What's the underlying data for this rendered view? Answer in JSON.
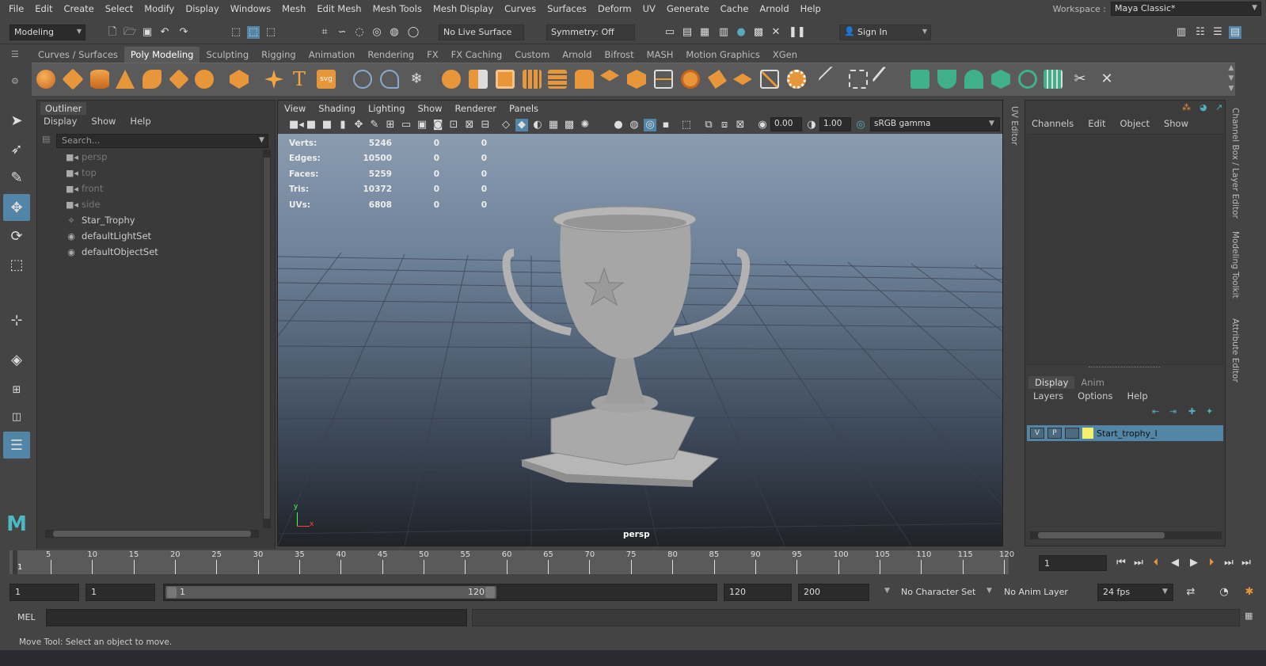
{
  "menubar": {
    "items": [
      "File",
      "Edit",
      "Create",
      "Select",
      "Modify",
      "Display",
      "Windows",
      "Mesh",
      "Edit Mesh",
      "Mesh Tools",
      "Mesh Display",
      "Curves",
      "Surfaces",
      "Deform",
      "UV",
      "Generate",
      "Cache",
      "Arnold",
      "Help"
    ],
    "workspace_label": "Workspace :",
    "workspace_value": "Maya Classic*"
  },
  "statusline": {
    "menuset": "Modeling",
    "live_surface": "No Live Surface",
    "symmetry": "Symmetry: Off",
    "sign_in": "Sign In"
  },
  "shelf": {
    "tabs": [
      "Curves / Surfaces",
      "Poly Modeling",
      "Sculpting",
      "Rigging",
      "Animation",
      "Rendering",
      "FX",
      "FX Caching",
      "Custom",
      "Arnold",
      "Bifrost",
      "MASH",
      "Motion Graphics",
      "XGen"
    ],
    "active_tab": "Poly Modeling",
    "text_icon": "T",
    "svg_icon": "svg"
  },
  "outliner": {
    "title": "Outliner",
    "menus": [
      "Display",
      "Show",
      "Help"
    ],
    "search_placeholder": "Search...",
    "items": [
      {
        "label": "persp",
        "icon": "camera-icon",
        "dim": true
      },
      {
        "label": "top",
        "icon": "camera-icon",
        "dim": true
      },
      {
        "label": "front",
        "icon": "camera-icon",
        "dim": true
      },
      {
        "label": "side",
        "icon": "camera-icon",
        "dim": true
      },
      {
        "label": "Star_Trophy",
        "icon": "transform-icon",
        "dim": false
      },
      {
        "label": "defaultLightSet",
        "icon": "set-icon",
        "dim": false
      },
      {
        "label": "defaultObjectSet",
        "icon": "set-icon",
        "dim": false
      }
    ]
  },
  "viewport": {
    "menus": [
      "View",
      "Shading",
      "Lighting",
      "Show",
      "Renderer",
      "Panels"
    ],
    "exposure": "0.00",
    "gamma": "1.00",
    "colorspace": "sRGB gamma",
    "camera_label": "persp",
    "hud": [
      {
        "key": "Verts:",
        "v1": "5246",
        "v2": "0",
        "v3": "0"
      },
      {
        "key": "Edges:",
        "v1": "10500",
        "v2": "0",
        "v3": "0"
      },
      {
        "key": "Faces:",
        "v1": "5259",
        "v2": "0",
        "v3": "0"
      },
      {
        "key": "Tris:",
        "v1": "10372",
        "v2": "0",
        "v3": "0"
      },
      {
        "key": "UVs:",
        "v1": "6808",
        "v2": "0",
        "v3": "0"
      }
    ],
    "axis_y": "y",
    "axis_x": "x"
  },
  "uv_editor_tab": "UV Editor",
  "channelbox": {
    "menus": [
      "Channels",
      "Edit",
      "Object",
      "Show"
    ],
    "layer_tabs": [
      "Display",
      "Anim"
    ],
    "layer_menus": [
      "Layers",
      "Options",
      "Help"
    ],
    "layer": {
      "v": "V",
      "p": "P",
      "name": "Start_trophy_l",
      "color": "#f5f06a"
    }
  },
  "side_tabs": [
    "Channel Box / Layer Editor",
    "Modeling Toolkit",
    "Attribute Editor"
  ],
  "timeline": {
    "ticks": [
      "5",
      "10",
      "15",
      "20",
      "25",
      "30",
      "35",
      "40",
      "45",
      "50",
      "55",
      "60",
      "65",
      "70",
      "75",
      "80",
      "85",
      "90",
      "95",
      "100",
      "105",
      "110",
      "115",
      "120"
    ],
    "first_tick": "1",
    "current_frame": "1"
  },
  "range": {
    "start": "1",
    "playback_start": "1",
    "slider_start": "1",
    "slider_end": "120",
    "playback_end": "120",
    "end": "200",
    "character_set": "No Character Set",
    "anim_layer": "No Anim Layer",
    "fps": "24 fps"
  },
  "cmdline": {
    "label": "MEL"
  },
  "helpline": {
    "text": "Move Tool: Select an object to move."
  },
  "colors": {
    "accent": "#5285a6",
    "shelf_orange": "#e8963a",
    "shelf_green": "#3fb08a"
  }
}
